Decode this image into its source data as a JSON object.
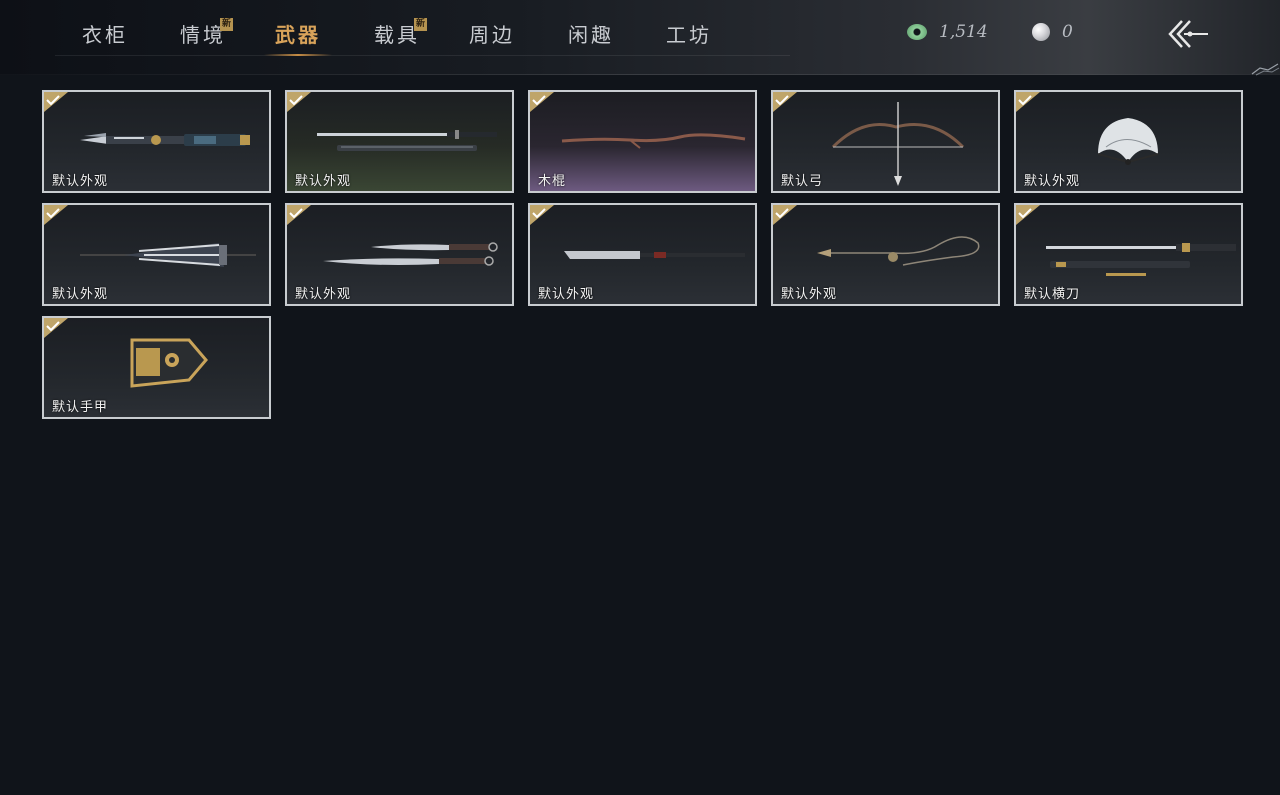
{
  "nav": {
    "tabs": [
      {
        "label": "衣柜",
        "new": false,
        "active": false
      },
      {
        "label": "情境",
        "new": true,
        "active": false
      },
      {
        "label": "武器",
        "new": false,
        "active": true
      },
      {
        "label": "载具",
        "new": true,
        "active": false
      },
      {
        "label": "周边",
        "new": false,
        "active": false
      },
      {
        "label": "闲趣",
        "new": false,
        "active": false
      },
      {
        "label": "工坊",
        "new": false,
        "active": false
      }
    ],
    "new_badge": "新"
  },
  "currency": {
    "jade": "1,514",
    "pearl": "0"
  },
  "items": [
    {
      "label": "默认外观",
      "icon": "spear-icon",
      "owned": true
    },
    {
      "label": "默认外观",
      "icon": "sword-icon",
      "owned": true
    },
    {
      "label": "木棍",
      "icon": "wooden-staff-icon",
      "owned": true
    },
    {
      "label": "默认弓",
      "icon": "bow-icon",
      "owned": true
    },
    {
      "label": "默认外观",
      "icon": "fan-icon",
      "owned": true
    },
    {
      "label": "默认外观",
      "icon": "umbrella-icon",
      "owned": true
    },
    {
      "label": "默认外观",
      "icon": "dual-blades-icon",
      "owned": true
    },
    {
      "label": "默认外观",
      "icon": "glaive-icon",
      "owned": true
    },
    {
      "label": "默认外观",
      "icon": "rope-dart-icon",
      "owned": true
    },
    {
      "label": "默认横刀",
      "icon": "hengdao-icon",
      "owned": true
    },
    {
      "label": "默认手甲",
      "icon": "gauntlet-icon",
      "owned": true
    }
  ],
  "colors": {
    "accent": "#d9a35a",
    "badge": "#b59350",
    "card_border": "#c8ccd0",
    "background": "#10141a"
  }
}
